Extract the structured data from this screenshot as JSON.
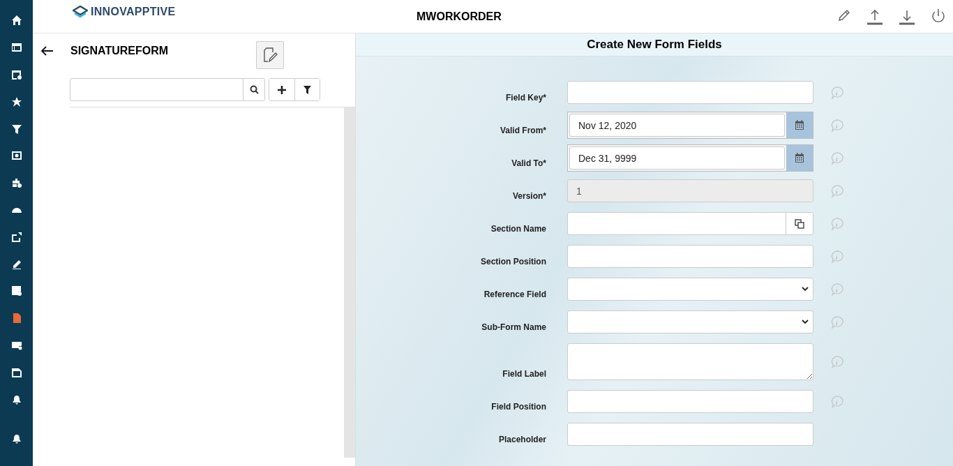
{
  "sidebar": {
    "items": [
      {
        "selected": false
      },
      {
        "selected": false
      },
      {
        "selected": false
      },
      {
        "selected": false
      },
      {
        "selected": false
      },
      {
        "selected": false
      },
      {
        "selected": false
      },
      {
        "selected": false
      },
      {
        "selected": false
      },
      {
        "selected": false
      },
      {
        "selected": false
      },
      {
        "selected": true
      },
      {
        "selected": false
      },
      {
        "selected": false
      },
      {
        "selected": false
      },
      {
        "selected": false
      }
    ]
  },
  "header": {
    "logo": "INNOVAPPTIVE",
    "title": "MWORKORDER"
  },
  "left_panel": {
    "title": "SIGNATUREFORM"
  },
  "form": {
    "title": "Create New Form Fields",
    "fields": [
      {
        "label": "Field Key*",
        "kind": "text",
        "info": true
      },
      {
        "label": "Valid From*",
        "kind": "date",
        "value": "Nov 12, 2020",
        "info": true
      },
      {
        "label": "Valid To*",
        "kind": "date",
        "value": "Dec 31, 9999",
        "info": true
      },
      {
        "label": "Version*",
        "kind": "disabled",
        "value": "1",
        "info": true
      },
      {
        "label": "Section Name",
        "kind": "copy",
        "info": true
      },
      {
        "label": "Section Position",
        "kind": "text",
        "info": true
      },
      {
        "label": "Reference Field",
        "kind": "select",
        "info": true
      },
      {
        "label": "Sub-Form Name",
        "kind": "select",
        "info": true
      },
      {
        "label": "Field Label",
        "kind": "textarea",
        "info": true
      },
      {
        "label": "Field Position",
        "kind": "text",
        "info": true
      },
      {
        "label": "Placeholder",
        "kind": "text",
        "info": false
      }
    ]
  }
}
